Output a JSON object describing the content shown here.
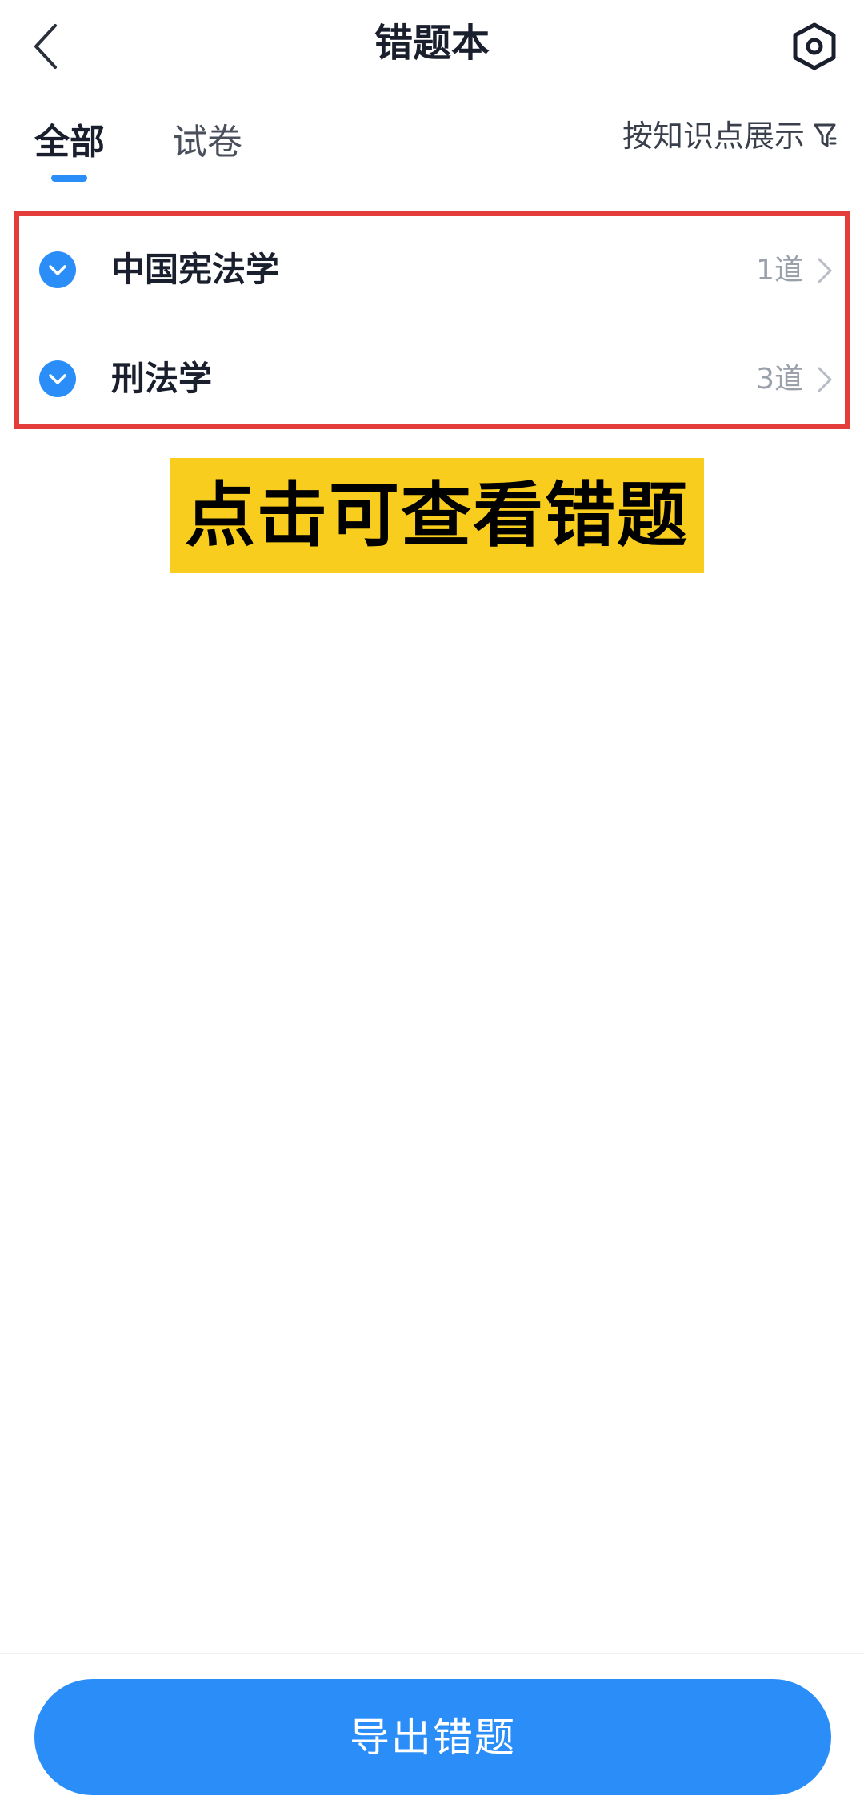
{
  "header": {
    "title": "错题本",
    "back_icon": "chevron-left-icon",
    "settings_icon": "hexagon-settings-icon"
  },
  "tabs": [
    {
      "label": "全部",
      "active": true
    },
    {
      "label": "试卷",
      "active": false
    }
  ],
  "filter": {
    "label": "按知识点展示",
    "icon": "filter-icon"
  },
  "subjects": [
    {
      "name": "中国宪法学",
      "count": "1道",
      "icon": "chevron-down-circle-icon"
    },
    {
      "name": "刑法学",
      "count": "3道",
      "icon": "chevron-down-circle-icon"
    }
  ],
  "banner": {
    "text": "点击可查看错题"
  },
  "footer": {
    "export_label": "导出错题"
  },
  "colors": {
    "accent": "#2b8ef8",
    "highlight_border": "#e43b3b",
    "banner_bg": "#f9cd1d",
    "text_primary": "#1a1f2e",
    "text_muted": "#9aa0aa"
  }
}
